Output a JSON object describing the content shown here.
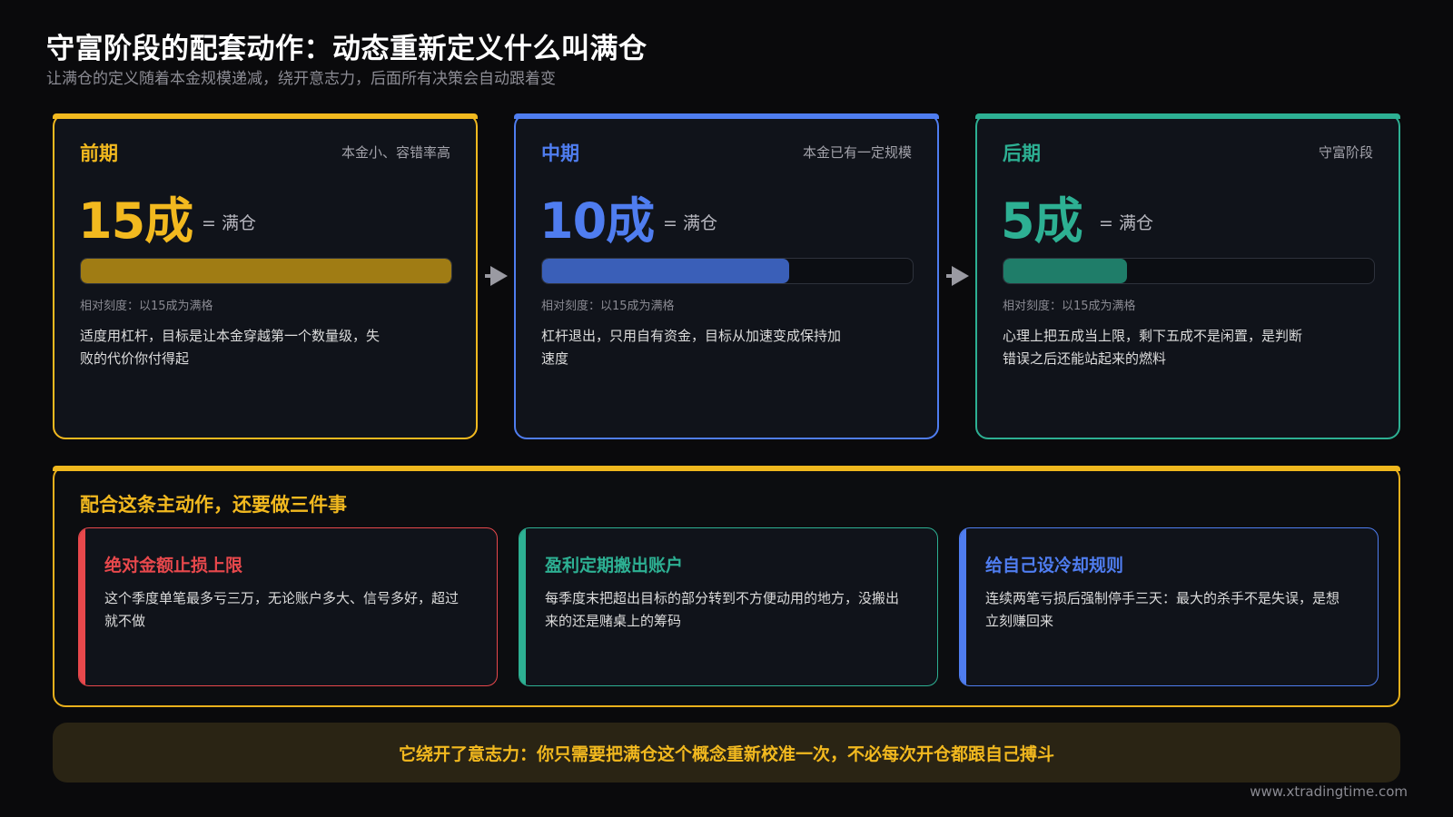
{
  "header": {
    "title": "守富阶段的配套动作：动态重新定义什么叫满仓",
    "subtitle": "让满仓的定义随着本金规模递减，绕开意志力，后面所有决策会自动跟着变"
  },
  "stages": [
    {
      "name": "前期",
      "note": "本金小、容错率高",
      "value": "15成",
      "eq": "= 满仓",
      "fill_fraction": 1.0,
      "scale": "相对刻度：以15成为满格",
      "desc": "适度用杠杆，目标是让本金穿越第一个数量级，失败的代价你付得起",
      "color": "#f2b91f",
      "fill_color": "#a07c14"
    },
    {
      "name": "中期",
      "note": "本金已有一定规模",
      "value": "10成",
      "eq": "= 满仓",
      "fill_fraction": 0.6667,
      "scale": "相对刻度：以15成为满格",
      "desc": "杠杆退出，只用自有资金，目标从加速变成保持加速度",
      "color": "#4f7df0",
      "fill_color": "#3a5fb8"
    },
    {
      "name": "后期",
      "note": "守富阶段",
      "value": "5成",
      "eq": "= 满仓",
      "fill_fraction": 0.3333,
      "scale": "相对刻度：以15成为满格",
      "desc": "心理上把五成当上限，剩下五成不是闲置，是判断错误之后还能站起来的燃料",
      "color": "#2db093",
      "fill_color": "#1f7d69"
    }
  ],
  "actions": {
    "heading": "配合这条主动作，还要做三件事",
    "items": [
      {
        "title": "绝对金额止损上限",
        "desc": "这个季度单笔最多亏三万，无论账户多大、信号多好，超过就不做",
        "color": "#e8484c"
      },
      {
        "title": "盈利定期搬出账户",
        "desc": "每季度末把超出目标的部分转到不方便动用的地方，没搬出来的还是赌桌上的筹码",
        "color": "#2db093"
      },
      {
        "title": "给自己设冷却规则",
        "desc": "连续两笔亏损后强制停手三天：最大的杀手不是失误，是想立刻赚回来",
        "color": "#4f7df0"
      }
    ]
  },
  "footer": {
    "text": "它绕开了意志力：你只需要把满仓这个概念重新校准一次，不必每次开仓都跟自己搏斗"
  },
  "site": "www.xtradingtime.com"
}
